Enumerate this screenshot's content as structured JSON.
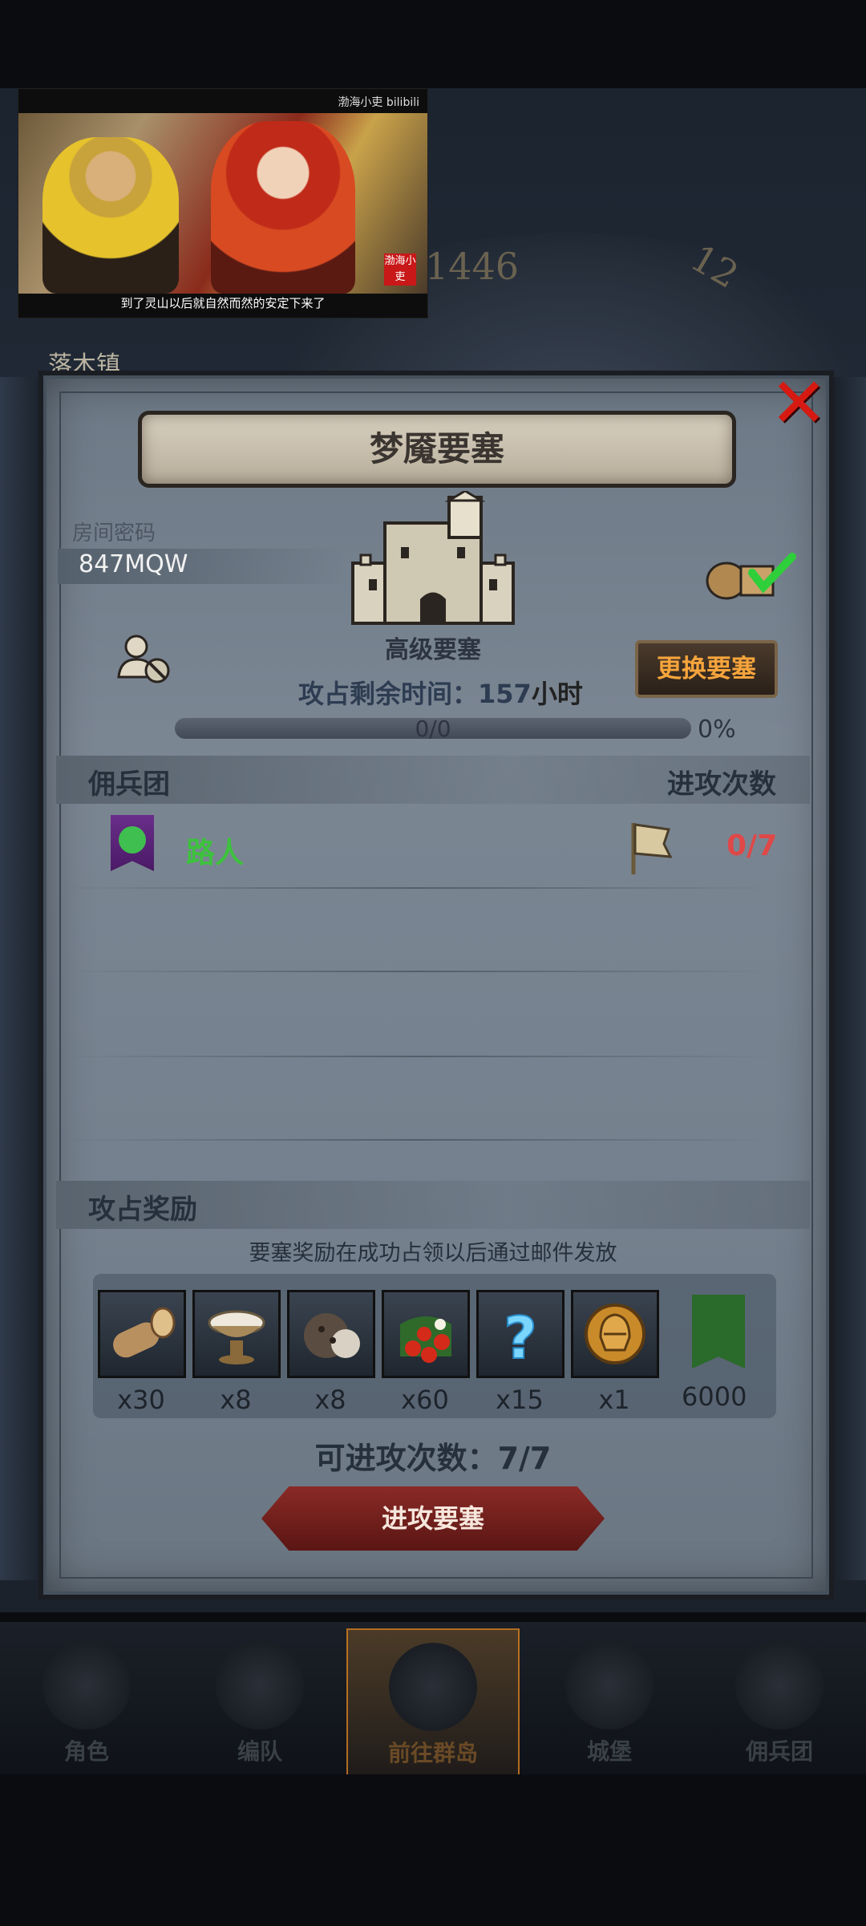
{
  "video": {
    "logo": "渤海小吏 bilibili",
    "stamp": "渤海小吏",
    "subtitle": "到了灵山以后就自然而然的安定下来了"
  },
  "background": {
    "clock_numbers": [
      "1446",
      "12"
    ],
    "town_name": "落木镇"
  },
  "panel": {
    "title": "梦魇要塞",
    "room_label": "房间密码",
    "room_code": "847MQW",
    "fortress_tier": "高级要塞",
    "change_button": "更换要塞",
    "timer_label": "攻占剩余时间：157",
    "timer_unit": "小时",
    "progress_text": "0/0",
    "progress_value": 0,
    "progress_percent": "0%",
    "section_mercenary": "佣兵团",
    "section_attacks": "进攻次数",
    "guild": {
      "name": "路人",
      "attacks": "0/7"
    },
    "section_rewards": "攻占奖励",
    "reward_note": "要塞奖励在成功占领以后通过邮件发放",
    "rewards": [
      {
        "icon": "wood-log-icon",
        "qty": "x30"
      },
      {
        "icon": "cream-bowl-icon",
        "qty": "x8"
      },
      {
        "icon": "truffle-icon",
        "qty": "x8"
      },
      {
        "icon": "berries-icon",
        "qty": "x60"
      },
      {
        "icon": "mystery-question-icon",
        "qty": "x15"
      },
      {
        "icon": "helmet-coin-icon",
        "qty": "x1"
      },
      {
        "icon": "tree-emblem-icon",
        "qty": "6000"
      }
    ],
    "remaining_attacks": "可进攻次数：7/7",
    "attack_button": "进攻要塞"
  },
  "nav": [
    {
      "label": "角色",
      "icon": "character-icon"
    },
    {
      "label": "编队",
      "icon": "formation-icon"
    },
    {
      "label": "前往群岛",
      "icon": "compass-icon",
      "active": true
    },
    {
      "label": "城堡",
      "icon": "castle-icon"
    },
    {
      "label": "佣兵团",
      "icon": "mercenary-icon"
    }
  ],
  "colors": {
    "close": "#d61a12",
    "guild_name": "#3cc23c",
    "attack_count": "#e04848",
    "change_button_text": "#f6a43c",
    "nav_active": "#d68022"
  }
}
